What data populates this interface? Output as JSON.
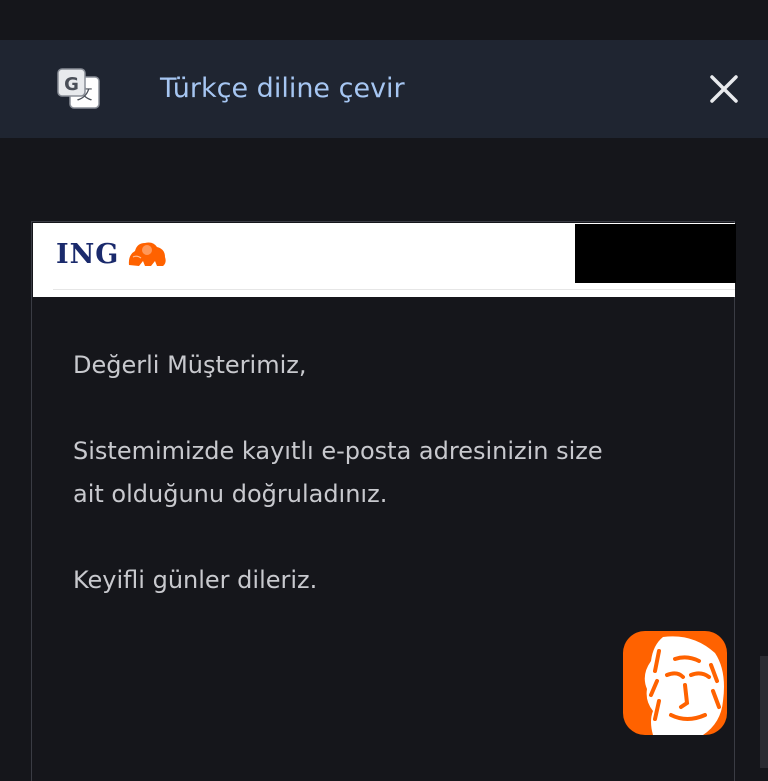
{
  "translate_bar": {
    "label": "Türkçe diline çevir",
    "icon": "google-translate-icon",
    "close_icon": "close-icon"
  },
  "email": {
    "brand": "ING",
    "brand_icon": "lion-icon",
    "brand_color": "#ff6200",
    "greeting": "Değerli Müşterimiz,",
    "message_lines": [
      "Sistemimizde kayıtlı e-posta adresinizin size",
      "ait olduğunu doğruladınız."
    ],
    "closing": "Keyifli günler dileriz."
  },
  "colors": {
    "background": "#15161b",
    "translate_bar": "#1f2531",
    "link_blue": "#a6c6f2",
    "text": "#c8c9ce"
  }
}
